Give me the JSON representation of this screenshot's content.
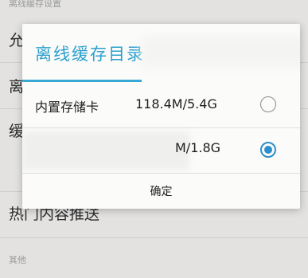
{
  "background": {
    "section_header_top": "离线缓存设置",
    "row_top_fragment": "允",
    "row_second_fragment": "离",
    "row_third_fragment": "缓",
    "row_hot": "热门内容推送",
    "section_header_other": "其他"
  },
  "dialog": {
    "title": "离线缓存目录",
    "options": [
      {
        "name": "内置存储卡",
        "size": "118.4M/5.4G",
        "selected": false
      },
      {
        "name": "",
        "size": "M/1.8G",
        "selected": true
      }
    ],
    "confirm_label": "确定"
  },
  "colors": {
    "accent": "#2aa0cf",
    "radio_checked": "#2d8fca"
  }
}
